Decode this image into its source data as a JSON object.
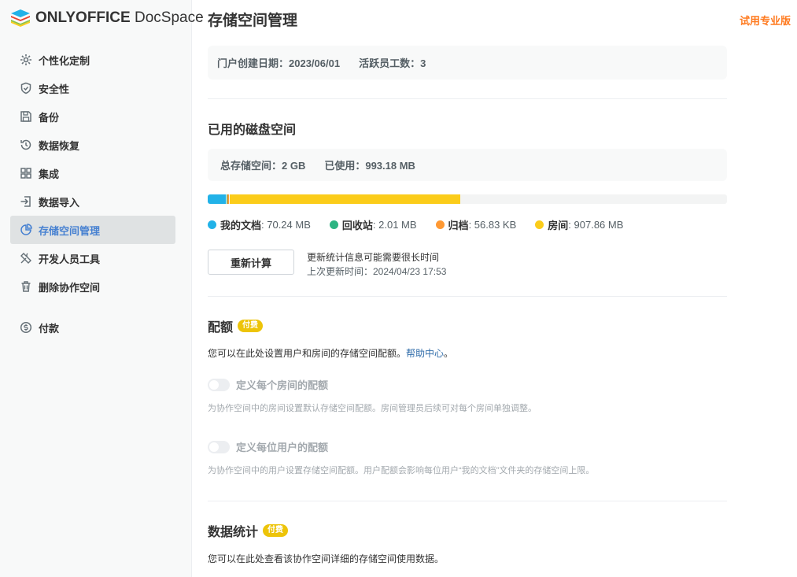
{
  "app": {
    "logo_bold": "ONLYOFFICE",
    "logo_light": " DocSpace"
  },
  "sidebar": {
    "items": [
      {
        "label": "个性化定制",
        "icon": "paint-icon"
      },
      {
        "label": "安全性",
        "icon": "shield-icon"
      },
      {
        "label": "备份",
        "icon": "save-icon"
      },
      {
        "label": "数据恢复",
        "icon": "history-icon"
      },
      {
        "label": "集成",
        "icon": "grid-icon"
      },
      {
        "label": "数据导入",
        "icon": "import-icon"
      },
      {
        "label": "存储空间管理",
        "icon": "storage-icon",
        "active": true
      },
      {
        "label": "开发人员工具",
        "icon": "tools-icon"
      },
      {
        "label": "删除协作空间",
        "icon": "trash-icon"
      }
    ],
    "payment": {
      "label": "付款",
      "icon": "dollar-icon"
    }
  },
  "header": {
    "title": "存储空间管理",
    "trial_link": "试用专业版"
  },
  "portal_info": {
    "created": "门户创建日期：2023/06/01",
    "active_users": "活跃员工数：3"
  },
  "disk": {
    "title": "已用的磁盘空间",
    "total": "总存储空间：2 GB",
    "used": "已使用：993.18 MB",
    "legend": [
      {
        "label": "我的文档",
        "value": ": 70.24 MB",
        "color": "#22b2e8",
        "fraction": 0.0343
      },
      {
        "label": "回收站",
        "value": ": 2.01 MB",
        "color": "#2db482",
        "fraction": 0.001
      },
      {
        "label": "归档",
        "value": ": 56.83 KB",
        "color": "#ff9933",
        "fraction": 0.003
      },
      {
        "label": "房间",
        "value": ": 907.86 MB",
        "color": "#fbcc1a",
        "fraction": 0.4433
      }
    ],
    "recalc_button": "重新计算",
    "recalc_note": "更新统计信息可能需要很长时间",
    "last_update": "上次更新时间：2024/04/23 17:53"
  },
  "quota": {
    "title": "配额",
    "badge": "付费",
    "description": "您可以在此处设置用户和房间的存储空间配额。",
    "help_link": "帮助中心",
    "period": "。",
    "room_toggle": "定义每个房间的配额",
    "room_hint": "为协作空间中的房间设置默认存储空间配额。房间管理员后续可对每个房间单独调整。",
    "user_toggle": "定义每位用户的配额",
    "user_hint": "为协作空间中的用户设置存储空间配额。用户配额会影响每位用户“我的文档”文件夹的存储空间上限。"
  },
  "statistics": {
    "title": "数据统计",
    "badge": "付费",
    "description": "您可以在此处查看该协作空间详细的存储空间使用数据。"
  }
}
